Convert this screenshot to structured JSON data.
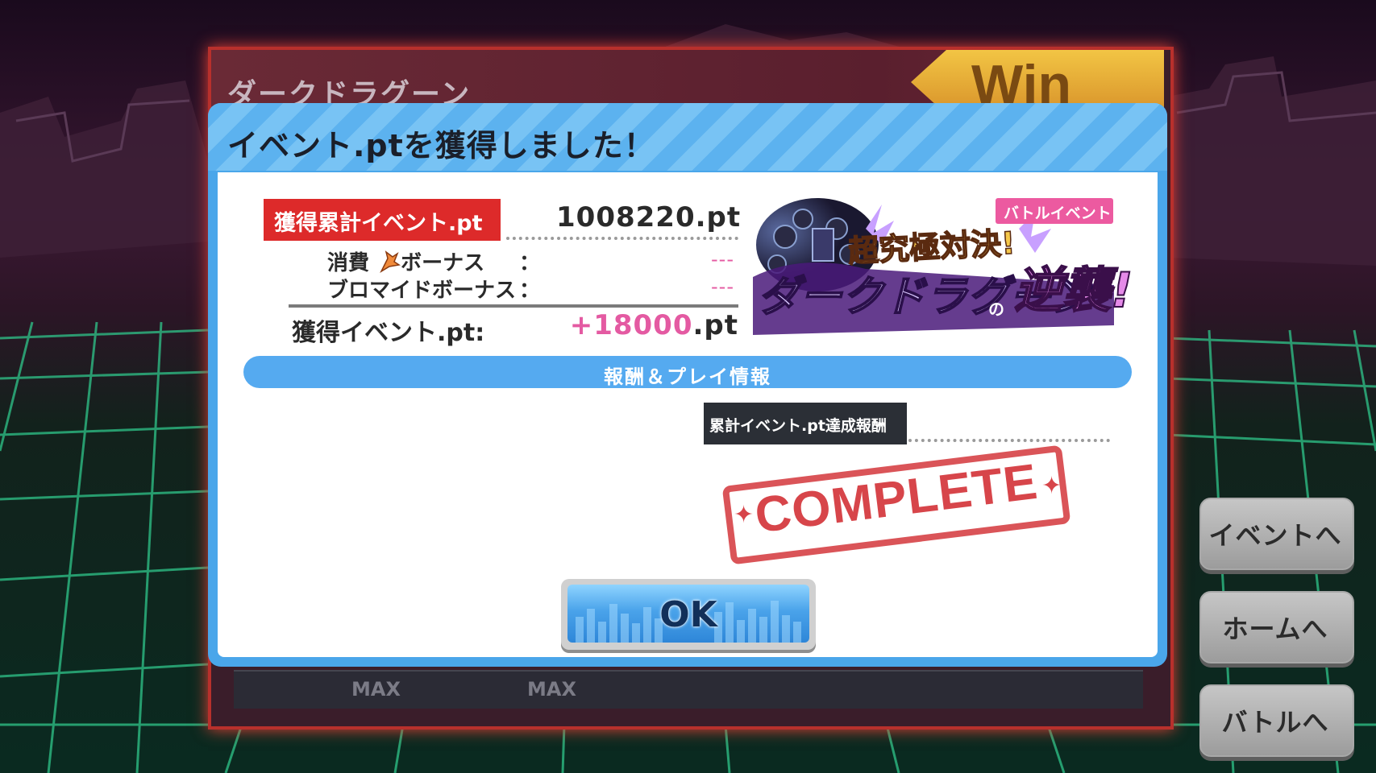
{
  "background": {
    "opponent_name": "ダークドラグーン",
    "result_badge": "Win",
    "max_labels": [
      "MAX",
      "MAX"
    ]
  },
  "dialog": {
    "title": "イベント.ptを獲得しました！",
    "total_label": "獲得累計イベント.pt",
    "total_value": "1008220.pt",
    "rows": [
      {
        "label": "消費 ",
        "icon": "flame-icon",
        "label_suffix": "ボーナス",
        "colon": "：",
        "value": "---"
      },
      {
        "label": "ブロマイドボーナス",
        "colon": "：",
        "value": "---"
      }
    ],
    "earned_label": "獲得イベント.pt:",
    "earned_value_num": "+18000",
    "earned_value_unit": ".pt",
    "banner": {
      "tag": "バトルイベント",
      "line1": "超究極対決!",
      "line2": "ダークドラグーン",
      "no": "の",
      "line3": "逆襲!"
    },
    "section_title": "報酬＆プレイ情報",
    "reward_label": "累計イベント.pt達成報酬",
    "stamp": "COMPLETE",
    "ok_label": "OK"
  },
  "side_buttons": {
    "event": "イベントへ",
    "home": "ホームへ",
    "battle": "バトルへ"
  },
  "colors": {
    "dialog_blue": "#4aa6ea",
    "total_tag_red": "#dd2a2a",
    "pink_value": "#e45aa2",
    "stamp_red": "#d7454a",
    "banner_tag_pink": "#ec5aa0"
  }
}
